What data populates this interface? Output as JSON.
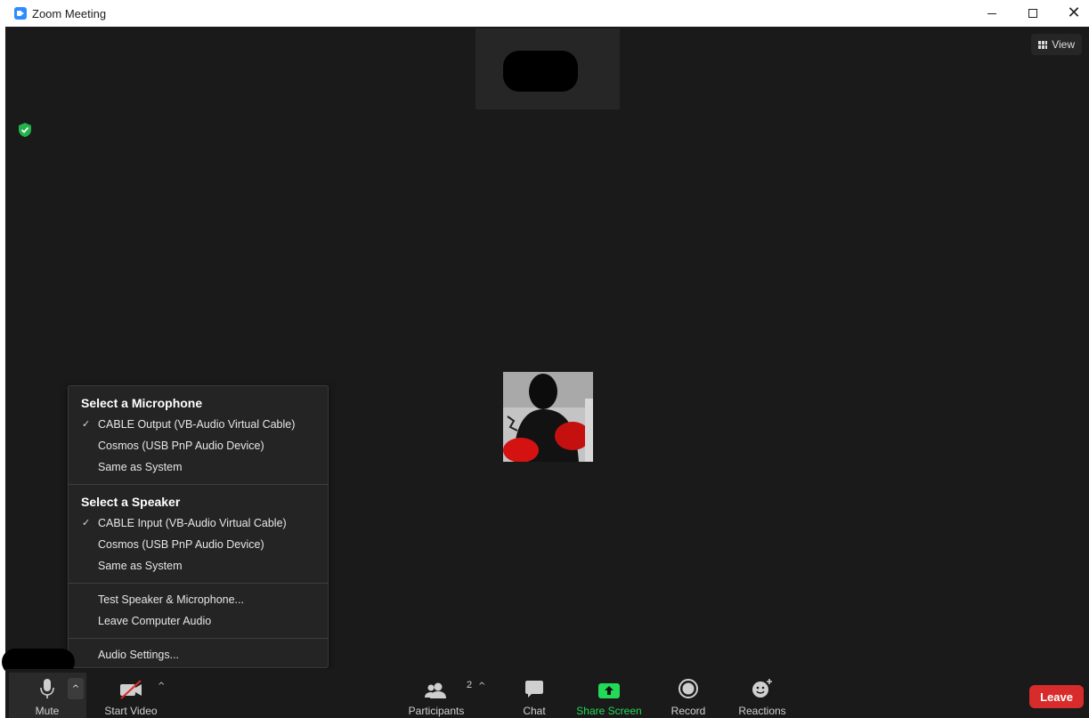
{
  "window": {
    "title": "Zoom Meeting",
    "controls": {
      "minimize": "minimize",
      "maximize": "maximize",
      "close": "close"
    }
  },
  "top_bar": {
    "view_label": "View"
  },
  "audio_menu": {
    "microphone_header": "Select a Microphone",
    "microphones": [
      {
        "label": "CABLE Output (VB-Audio Virtual Cable)",
        "selected": true
      },
      {
        "label": "Cosmos (USB PnP Audio Device)",
        "selected": false
      },
      {
        "label": "Same as System",
        "selected": false
      }
    ],
    "speaker_header": "Select a Speaker",
    "speakers": [
      {
        "label": "CABLE Input (VB-Audio Virtual Cable)",
        "selected": true
      },
      {
        "label": "Cosmos (USB PnP Audio Device)",
        "selected": false
      },
      {
        "label": "Same as System",
        "selected": false
      }
    ],
    "check_mark": "✓",
    "test_label": "Test Speaker & Microphone...",
    "leave_audio_label": "Leave Computer Audio",
    "settings_label": "Audio Settings..."
  },
  "toolbar": {
    "mute_label": "Mute",
    "start_video_label": "Start Video",
    "participants_label": "Participants",
    "participants_count": "2",
    "chat_label": "Chat",
    "share_screen_label": "Share Screen",
    "record_label": "Record",
    "reactions_label": "Reactions",
    "leave_label": "Leave"
  },
  "colors": {
    "accent_green": "#23d959",
    "leave_red": "#d82c2c",
    "zoom_blue": "#2d8cff",
    "background": "#1a1a1a"
  }
}
